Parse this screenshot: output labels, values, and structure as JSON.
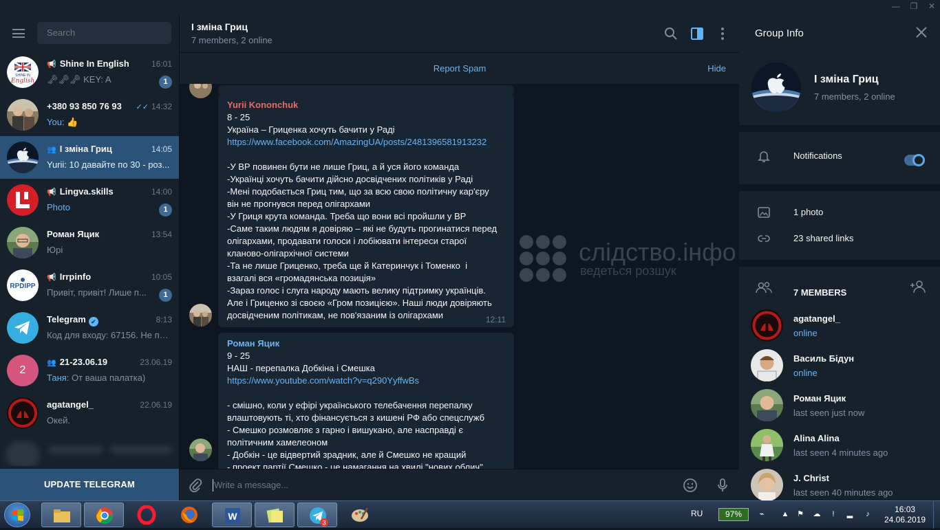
{
  "window": {
    "controls": [
      "—",
      "❐",
      "✕"
    ]
  },
  "sidebar": {
    "search_placeholder": "Search",
    "chats": [
      {
        "name": "Shine In English",
        "type": "channel",
        "time": "16:01",
        "preview": "🗝🗝🗝 KEY: A",
        "badge": "1"
      },
      {
        "name": "+380 93 850 76 93",
        "type": "user",
        "time": "14:32",
        "sender": "You:",
        "preview": "👍",
        "status": "read"
      },
      {
        "name": "І зміна Гриц",
        "type": "group",
        "time": "14:05",
        "preview": "Yurii: 10 давайте по 30 - роз...",
        "active": true
      },
      {
        "name": "Lingva.skills",
        "type": "channel",
        "time": "14:00",
        "preview": "Photo",
        "badge": "1"
      },
      {
        "name": "Роман Яцик",
        "type": "user",
        "time": "13:54",
        "preview": "Юрі"
      },
      {
        "name": "Irrpinfo",
        "type": "channel",
        "time": "10:05",
        "preview": "Привіт, привіт!  Лише п...",
        "badge": "1"
      },
      {
        "name": "Telegram",
        "type": "verified",
        "time": "8:13",
        "preview": "Код для входу: 67156. Не по..."
      },
      {
        "name": "21-23.06.19",
        "type": "group",
        "time": "23.06.19",
        "sender": "Таня:",
        "preview": "От ваша палатка)",
        "avatar_letter": "2"
      },
      {
        "name": "agatangel_",
        "type": "user",
        "time": "22.06.19",
        "preview": "Окей."
      }
    ],
    "update_label": "UPDATE TELEGRAM"
  },
  "chat": {
    "title": "І зміна Гриц",
    "subtitle": "7 members, 2 online",
    "report_spam": "Report Spam",
    "hide": "Hide",
    "composer_placeholder": "Write a message...",
    "messages": [
      {
        "author": "Yurii Kononchuk",
        "author_color": "#e36d6d",
        "time": "12:11",
        "lines": [
          "8 - 25",
          "Україна – Гриценка хочуть бачити у Раді",
          "https://www.facebook.com/AmazingUA/posts/2481396581913232",
          " ",
          "-У ВР повинен бути не лише Гриц, а й уся його команда",
          "-Українці хочуть бачити дійсно досвідчених політиків у Раді",
          "-Мені подобається Гриц тим, що за всю свою політичну кар'єру",
          "він не прогнувся перед олігархами",
          "-У Гриця крута команда. Треба що вони всі пройшли у ВР",
          "-Саме таким людям я довіряю – які не будуть прогинатися перед",
          "олігархами, продавати голоси і лобіювати інтереси старої",
          "кланово-олігархічної системи",
          "-Та не лише Гриценко, треба ще й Катеринчук і Томенко  і",
          "взагалі вся «громадянська позиція»",
          "-Зараз голос і слуга народу мають велику підтримку українців.",
          "Але і Гриценко зі своєю «Гром позицією». Наші люди довіряють",
          "досвідченим політикам, не пов'язаним із олігархами"
        ]
      },
      {
        "author": "Роман Яцик",
        "author_color": "#6ab3f3",
        "lines": [
          "9 - 25",
          "НАШ - перепалка Добкіна і Смешка",
          "https://www.youtube.com/watch?v=q290YyffwBs",
          " ",
          "- смішно, коли у ефірі українського телебачення перепалку",
          "влаштовують ті, хто фінансується з кишені РФ або спецслужб",
          "- Смешко розмовляє з гарно і вишукано, але насправді є",
          "політичним хамелеоном",
          "- Добкін - це відвертий зрадник, але й Смешко не кращий",
          "- проект партії Смешко - це намагання на хвилі \"нових облич\""
        ]
      }
    ],
    "watermark": {
      "text": "слідство.інфо",
      "sub": "ведеться розшук"
    }
  },
  "info": {
    "title": "Group Info",
    "group_name": "І зміна Гриц",
    "group_sub": "7 members, 2 online",
    "notifications_label": "Notifications",
    "notifications_on": true,
    "photos_label": "1 photo",
    "links_label": "23 shared links",
    "members_title": "7 MEMBERS",
    "members": [
      {
        "name": "agatangel_",
        "status": "online",
        "online": true
      },
      {
        "name": "Василь Бідун",
        "status": "online",
        "online": true
      },
      {
        "name": "Роман Яцик",
        "status": "last seen just now"
      },
      {
        "name": "Alina Alina",
        "status": "last seen 4 minutes ago"
      },
      {
        "name": "J. Christ",
        "status": "last seen 40 minutes ago"
      }
    ]
  },
  "taskbar": {
    "lang": "RU",
    "battery": "97%",
    "time": "16:03",
    "date": "24.06.2019",
    "telegram_badge": "3"
  },
  "colors": {
    "accent": "#6ab3f3",
    "active_chat": "#2b5278",
    "panel": "#17212b",
    "bg": "#0e1621"
  }
}
